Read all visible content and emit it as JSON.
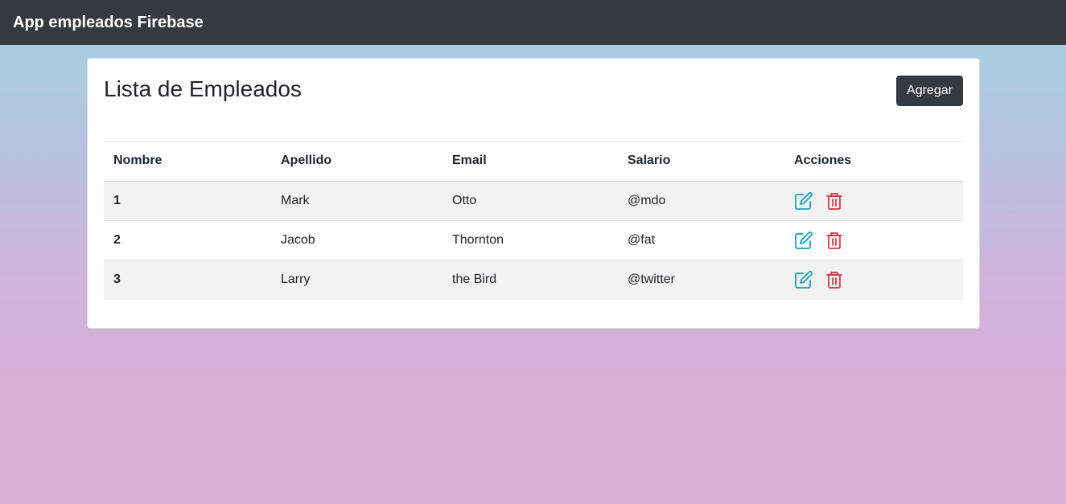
{
  "navbar": {
    "brand": "App empleados Firebase"
  },
  "card": {
    "title": "Lista de Empleados",
    "add_label": "Agregar"
  },
  "table": {
    "headers": [
      "Nombre",
      "Apellido",
      "Email",
      "Salario",
      "Acciones"
    ],
    "rows": [
      {
        "id": "1",
        "first": "Mark",
        "last": "Otto",
        "handle": "@mdo"
      },
      {
        "id": "2",
        "first": "Jacob",
        "last": "Thornton",
        "handle": "@fat"
      },
      {
        "id": "3",
        "first": "Larry",
        "last": "the Bird",
        "handle": "@twitter"
      }
    ]
  },
  "colors": {
    "navbar": "#343a40",
    "edit_icon": "#17a2b8",
    "delete_icon": "#dc3545"
  },
  "icons": {
    "edit": "edit-icon",
    "delete": "trash-icon"
  }
}
